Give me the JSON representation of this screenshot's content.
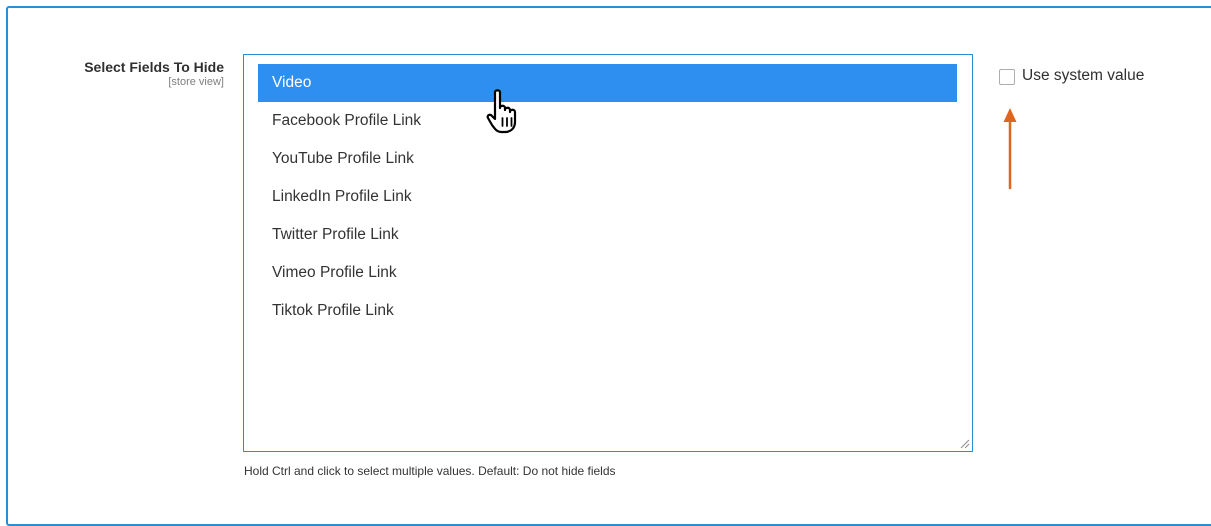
{
  "field": {
    "label": "Select Fields To Hide",
    "scope": "[store view]",
    "options": [
      {
        "label": "Video",
        "selected": true
      },
      {
        "label": "Facebook Profile Link",
        "selected": false
      },
      {
        "label": "YouTube Profile Link",
        "selected": false
      },
      {
        "label": "LinkedIn Profile Link",
        "selected": false
      },
      {
        "label": "Twitter Profile Link",
        "selected": false
      },
      {
        "label": "Vimeo Profile Link",
        "selected": false
      },
      {
        "label": "Tiktok Profile Link",
        "selected": false
      }
    ],
    "hint": "Hold Ctrl and click to select multiple values. Default: Do not hide fields"
  },
  "use_system_value": {
    "label": "Use system value",
    "checked": false
  },
  "icons": {
    "cursor": "hand-pointer-icon",
    "annotation": "arrow-up-icon",
    "resize": "resize-grip-icon"
  },
  "colors": {
    "frame_border": "#2a8fd0",
    "selected_bg": "#2e8ff0",
    "annotation_arrow": "#e0651f"
  }
}
